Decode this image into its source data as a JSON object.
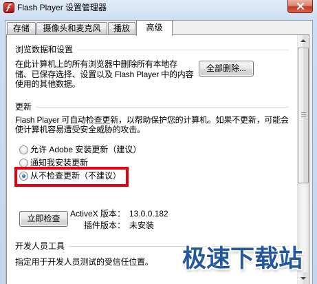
{
  "window": {
    "title": "Flash Player 设置管理器",
    "app_icon": "flash-player-icon",
    "close_icon": "close-icon"
  },
  "tabs": [
    {
      "label": "存储",
      "selected": false
    },
    {
      "label": "摄像头和麦克风",
      "selected": false
    },
    {
      "label": "播放",
      "selected": false
    },
    {
      "label": "高级",
      "selected": true
    }
  ],
  "browsing_data": {
    "heading": "浏览数据和设置",
    "lines": [
      "在此计算机上的所有浏览器中删除所有本地存",
      "储、已保存选择、设置以及 Flash Player 中的内容",
      "使用的其他数据。"
    ],
    "delete_all_button": "全部删除..."
  },
  "updates": {
    "heading": "更新",
    "lines": [
      "Flash Player 可自动检查更新，以帮助保护您的计算机。如果不更新，可能会",
      "使计算机容易遭受安全威胁的攻击。"
    ],
    "options": [
      {
        "label": "允许 Adobe 安装更新（建议）",
        "selected": false
      },
      {
        "label": "通知我安装更新",
        "selected": false
      },
      {
        "label": "从不检查更新（不建议）",
        "selected": true
      }
    ],
    "check_now_button": "立即检查",
    "versions": {
      "activex_label": "ActiveX 版本：",
      "activex_value": "13.0.0.182",
      "plugin_label": "插件版本：",
      "plugin_value": "未安装"
    }
  },
  "developer_tools": {
    "heading": "开发人员工具",
    "lines": [
      "指定用于开发人员测试的受信任位置。"
    ]
  },
  "scrollbar": {
    "scroll_fraction": 0,
    "up_icon": "scroll-up-icon",
    "down_icon": "scroll-down-icon"
  },
  "watermark": {
    "text": "极速下载站"
  },
  "colors": {
    "highlight": "#e60012",
    "watermark": "#24589c"
  }
}
